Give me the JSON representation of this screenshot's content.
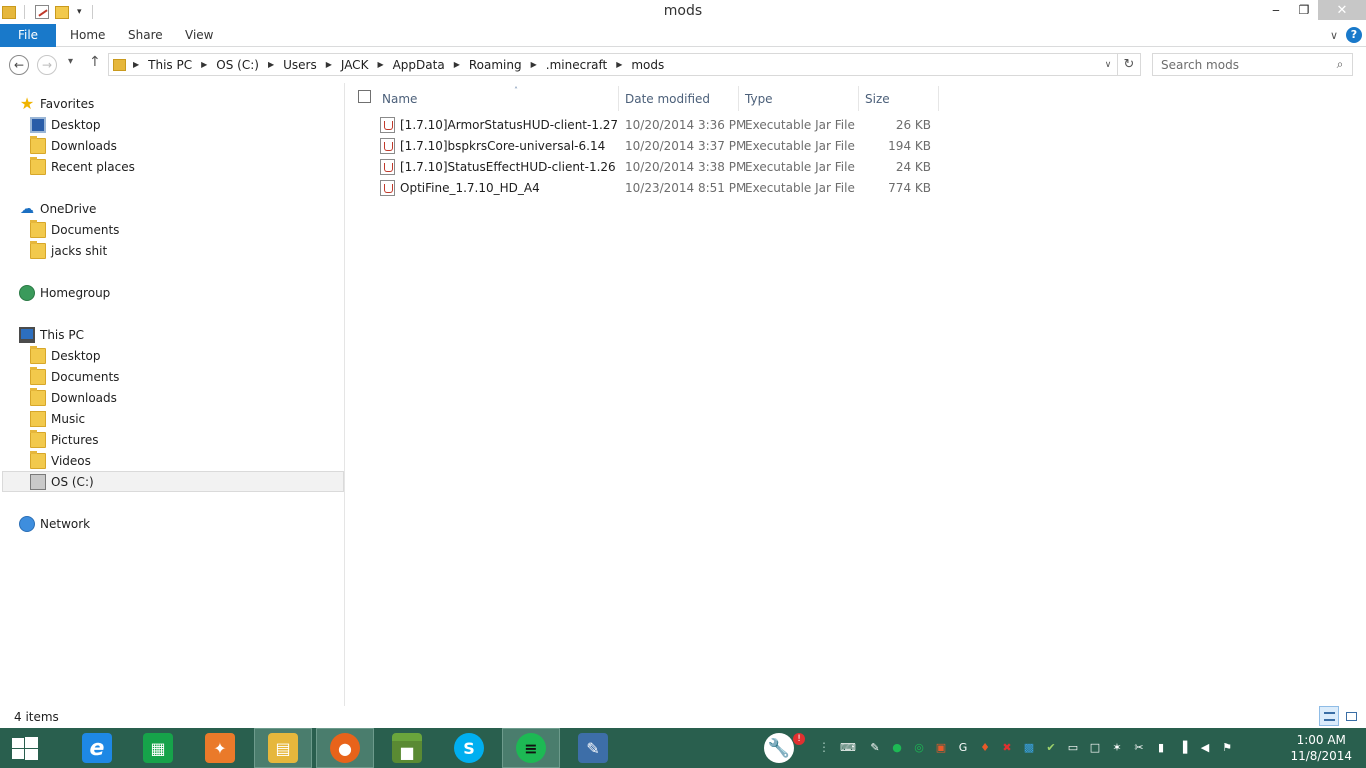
{
  "window": {
    "title": "mods",
    "min_glyph": "‒",
    "restore_glyph": "❐",
    "close_glyph": "✕"
  },
  "ribbon": {
    "tabs": [
      "File",
      "Home",
      "Share",
      "View"
    ],
    "help_glyph": "?",
    "expand_glyph": "∨"
  },
  "nav": {
    "back_glyph": "←",
    "forward_glyph": "→",
    "recent_glyph": "▾",
    "up_glyph": "↑"
  },
  "address": {
    "crumbs": [
      "This PC",
      "OS (C:)",
      "Users",
      "JACK",
      "AppData",
      "Roaming",
      ".minecraft",
      "mods"
    ],
    "separator": "▶",
    "dropdown_glyph": "∨",
    "refresh_glyph": "↻"
  },
  "search": {
    "placeholder": "Search mods",
    "icon_glyph": "⌕"
  },
  "navpane": {
    "favorites": {
      "label": "Favorites",
      "items": [
        "Desktop",
        "Downloads",
        "Recent places"
      ]
    },
    "onedrive": {
      "label": "OneDrive",
      "items": [
        "Documents",
        "jacks shit"
      ]
    },
    "homegroup": {
      "label": "Homegroup"
    },
    "thispc": {
      "label": "This PC",
      "items": [
        "Desktop",
        "Documents",
        "Downloads",
        "Music",
        "Pictures",
        "Videos",
        "OS (C:)"
      ]
    },
    "network": {
      "label": "Network"
    }
  },
  "columns": {
    "name": "Name",
    "date": "Date modified",
    "type": "Type",
    "size": "Size",
    "sort_glyph": "˄"
  },
  "files": [
    {
      "name": "[1.7.10]ArmorStatusHUD-client-1.27",
      "date": "10/20/2014 3:36 PM",
      "type": "Executable Jar File",
      "size": "26 KB"
    },
    {
      "name": "[1.7.10]bspkrsCore-universal-6.14",
      "date": "10/20/2014 3:37 PM",
      "type": "Executable Jar File",
      "size": "194 KB"
    },
    {
      "name": "[1.7.10]StatusEffectHUD-client-1.26",
      "date": "10/20/2014 3:38 PM",
      "type": "Executable Jar File",
      "size": "24 KB"
    },
    {
      "name": "OptiFine_1.7.10_HD_A4",
      "date": "10/23/2014 8:51 PM",
      "type": "Executable Jar File",
      "size": "774 KB"
    }
  ],
  "status": {
    "count": "4 items"
  },
  "taskbar": {
    "badge": "!",
    "apps": [
      {
        "icon": "ie-icon",
        "glyph": "e",
        "color": "#1e88e5"
      },
      {
        "icon": "store-icon",
        "glyph": "▦",
        "color": "#16a34a"
      },
      {
        "icon": "orange-app-icon",
        "glyph": "✦",
        "color": "#ea7a2a"
      },
      {
        "icon": "file-explorer-icon",
        "glyph": "▤",
        "color": "#e6b73c"
      },
      {
        "icon": "firefox-icon",
        "glyph": "●",
        "color": "#e8631a"
      },
      {
        "icon": "minecraft-icon",
        "glyph": "■",
        "color": "#5a8a33"
      },
      {
        "icon": "skype-icon",
        "glyph": "S",
        "color": "#00aff0"
      },
      {
        "icon": "spotify-icon",
        "glyph": "≡",
        "color": "#1db954"
      },
      {
        "icon": "paint-icon",
        "glyph": "✎",
        "color": "#3d6ea8"
      }
    ],
    "tray_glyphs": [
      "⌨",
      "✎",
      "●",
      "◎",
      "▣",
      "G",
      "♦",
      "✖",
      "▩",
      "✔",
      "▭",
      "□",
      "✶",
      "✂",
      "▮",
      "▐",
      "◀",
      "⚑"
    ],
    "time": "1:00 AM",
    "date": "11/8/2014"
  }
}
